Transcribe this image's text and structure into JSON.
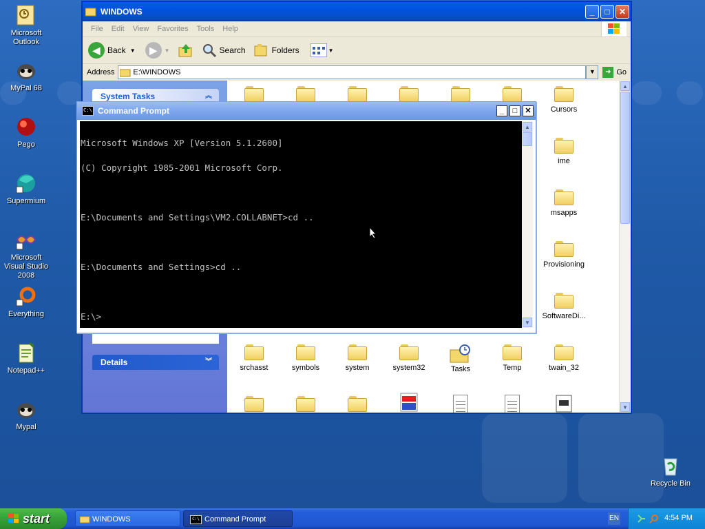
{
  "desktop": {
    "icons": [
      {
        "label": "Microsoft Outlook",
        "icon": "outlook-icon"
      },
      {
        "label": "MyPal 68",
        "icon": "mypal-icon"
      },
      {
        "label": "Pego",
        "icon": "pego-icon"
      },
      {
        "label": "Supermium",
        "icon": "supermium-icon"
      },
      {
        "label": "Microsoft Visual Studio 2008",
        "icon": "visual-studio-icon"
      },
      {
        "label": "Everything",
        "icon": "everything-icon"
      },
      {
        "label": "Notepad++",
        "icon": "notepadpp-icon"
      },
      {
        "label": "Mypal",
        "icon": "mypal-icon"
      },
      {
        "label": "Recycle Bin",
        "icon": "recycle-bin-icon"
      }
    ]
  },
  "explorer": {
    "title": "WINDOWS",
    "menu": [
      "File",
      "Edit",
      "View",
      "Favorites",
      "Tools",
      "Help"
    ],
    "toolbar": {
      "back": "Back",
      "search": "Search",
      "folders": "Folders"
    },
    "address": {
      "label": "Address",
      "value": "E:\\WINDOWS",
      "go": "Go"
    },
    "tasks": {
      "system_tasks": "System Tasks",
      "details": "Details"
    },
    "folders_right_column": [
      "Cursors",
      "ime",
      "msapps",
      "Provisioning",
      "SoftwareDi..."
    ],
    "folders_bottom_row": [
      "srchasst",
      "symbols",
      "system",
      "system32",
      "Tasks",
      "Temp",
      "twain_32"
    ]
  },
  "cmd": {
    "title": "Command Prompt",
    "lines": [
      "Microsoft Windows XP [Version 5.1.2600]",
      "(C) Copyright 1985-2001 Microsoft Corp.",
      "",
      "E:\\Documents and Settings\\VM2.COLLABNET>cd ..",
      "",
      "E:\\Documents and Settings>cd ..",
      "",
      "E:\\>"
    ]
  },
  "taskbar": {
    "start": "start",
    "buttons": [
      {
        "label": "WINDOWS",
        "active": false
      },
      {
        "label": "Command Prompt",
        "active": true
      }
    ],
    "language": "EN",
    "clock": "4:54 PM"
  },
  "colors": {
    "desktop": "#2460b8",
    "xp_blue": "#0054e3",
    "start_green": "#36a036",
    "tray": "#0f83d6"
  }
}
